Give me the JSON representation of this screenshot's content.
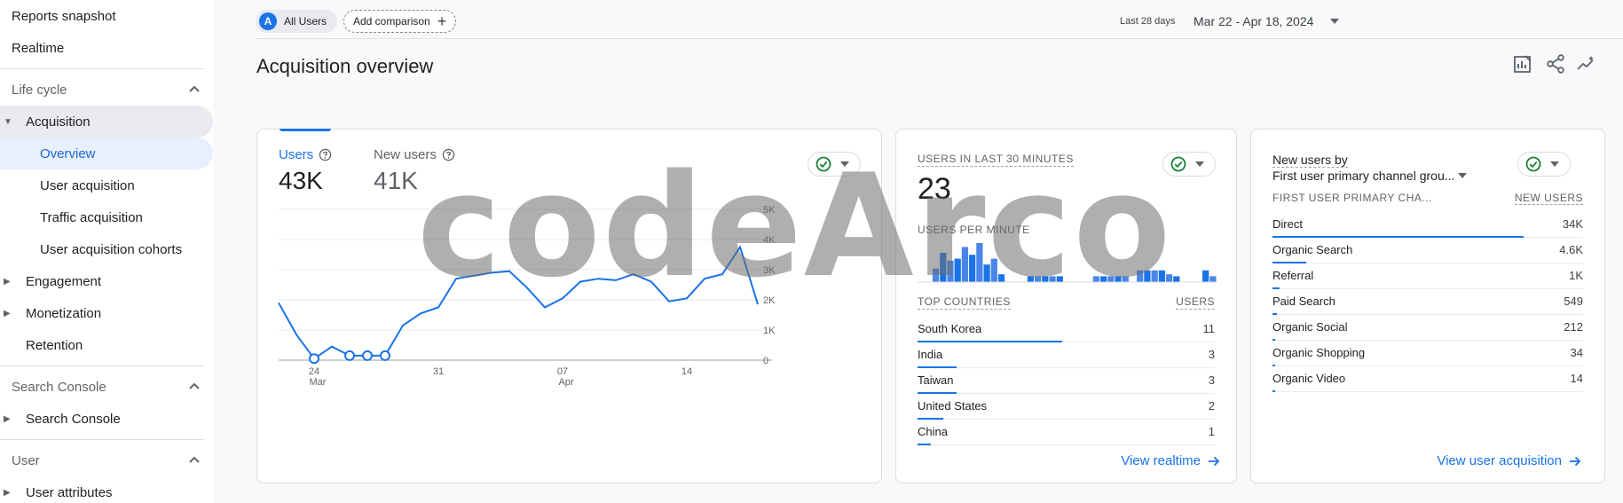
{
  "sidebar": {
    "reports_snapshot": "Reports snapshot",
    "realtime": "Realtime",
    "lifecycle": "Life cycle",
    "acquisition": "Acquisition",
    "overview": "Overview",
    "user_acquisition": "User acquisition",
    "traffic_acquisition": "Traffic acquisition",
    "user_acquisition_cohorts": "User acquisition cohorts",
    "engagement": "Engagement",
    "monetization": "Monetization",
    "retention": "Retention",
    "search_console_section": "Search Console",
    "search_console": "Search Console",
    "user_section": "User",
    "user_attributes": "User attributes"
  },
  "topbar": {
    "segment_avatar": "A",
    "segment": "All Users",
    "add_comparison": "Add comparison",
    "range_label": "Last 28 days",
    "range_value": "Mar 22 - Apr 18, 2024"
  },
  "page": {
    "title": "Acquisition overview"
  },
  "card1": {
    "users_label": "Users",
    "users_value": "43K",
    "new_users_label": "New users",
    "new_users_value": "41K"
  },
  "chart_data": {
    "type": "line",
    "series": [
      {
        "values": [
          1900,
          850,
          50,
          450,
          150,
          150,
          150,
          1150,
          1550,
          1750,
          2700,
          2800,
          2900,
          2950,
          2400,
          1750,
          2050,
          2600,
          2700,
          2650,
          2850,
          2600,
          1950,
          2050,
          2700,
          2850,
          3750,
          1850
        ]
      }
    ],
    "x_tick_labels": [
      {
        "day": "24",
        "month": "Mar"
      },
      {
        "day": "31",
        "month": ""
      },
      {
        "day": "07",
        "month": "Apr"
      },
      {
        "day": "14",
        "month": ""
      }
    ],
    "y_ticks": [
      "5K",
      "4K",
      "3K",
      "2K",
      "1K",
      "0"
    ],
    "ylim": [
      0,
      5000
    ],
    "hollow_markers_at": [
      2,
      4,
      5,
      6
    ],
    "color": "#1a73e8"
  },
  "card2": {
    "users_30min_label": "USERS IN LAST 30 MINUTES",
    "users_30min_value": "23",
    "per_minute_label": "USERS PER MINUTE",
    "top_countries_label": "TOP COUNTRIES",
    "users_col_label": "USERS",
    "per_minute_bars": [
      0,
      0,
      0.35,
      0.75,
      0.55,
      0.6,
      0.9,
      0.7,
      1.0,
      0.45,
      0.6,
      0.2,
      0,
      0,
      0,
      0.15,
      0.15,
      0.15,
      0.15,
      0.15,
      0,
      0,
      0,
      0,
      0.15,
      0.15,
      0.15,
      0.15,
      0.15,
      0,
      0.3,
      0.3,
      0.3,
      0.3,
      0.2,
      0.15,
      0,
      0,
      0,
      0.3,
      0.15
    ],
    "countries": [
      {
        "name": "South Korea",
        "value": "11",
        "share": 1.0
      },
      {
        "name": "India",
        "value": "3",
        "share": 0.27
      },
      {
        "name": "Taiwan",
        "value": "3",
        "share": 0.27
      },
      {
        "name": "United States",
        "value": "2",
        "share": 0.18
      },
      {
        "name": "China",
        "value": "1",
        "share": 0.09
      }
    ],
    "link": "View realtime"
  },
  "card3": {
    "title_line1": "New users by",
    "title_line2": "First user primary channel grou...",
    "col1_label": "FIRST USER PRIMARY CHA...",
    "col2_label": "NEW USERS",
    "rows": [
      {
        "name": "Direct",
        "value": "34K",
        "share": 1.0
      },
      {
        "name": "Organic Search",
        "value": "4.6K",
        "share": 0.135
      },
      {
        "name": "Referral",
        "value": "1K",
        "share": 0.03
      },
      {
        "name": "Paid Search",
        "value": "549",
        "share": 0.016
      },
      {
        "name": "Organic Social",
        "value": "212",
        "share": 0.006
      },
      {
        "name": "Organic Shopping",
        "value": "34",
        "share": 0.001
      },
      {
        "name": "Organic Video",
        "value": "14",
        "share": 0.0004
      }
    ],
    "link": "View user acquisition"
  },
  "watermark": "codeArco",
  "colors": {
    "accent": "#1a73e8",
    "check": "#188038"
  }
}
